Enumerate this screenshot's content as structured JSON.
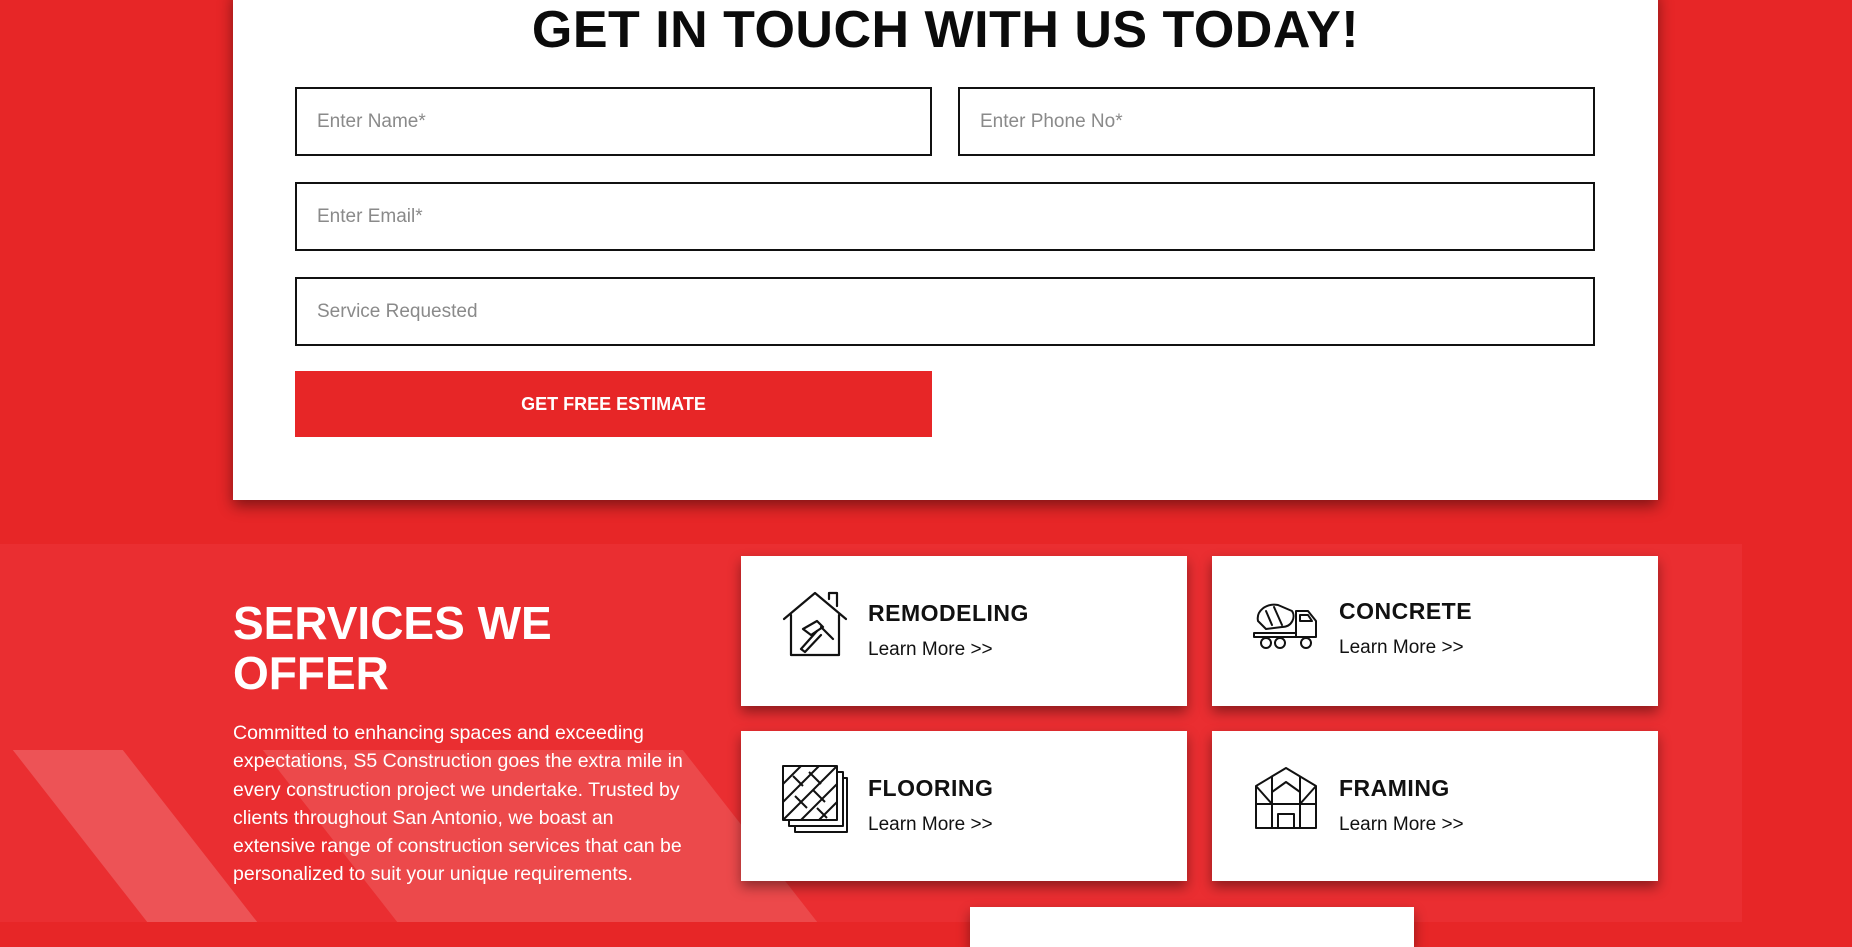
{
  "contact_form": {
    "title": "GET IN TOUCH WITH US TODAY!",
    "name_placeholder": "Enter Name*",
    "phone_placeholder": "Enter Phone No*",
    "email_placeholder": "Enter Email*",
    "service_placeholder": "Service Requested",
    "submit_label": "GET FREE ESTIMATE"
  },
  "services": {
    "heading": "SERVICES WE OFFER",
    "description": "Committed to enhancing spaces and exceeding expectations, S5 Construction goes the extra mile in every construction project we undertake. Trusted by clients throughout San Antonio, we boast an extensive range of construction services that can be personalized to suit your unique requirements.",
    "items": [
      {
        "title": "REMODELING",
        "link": "Learn More >>",
        "icon": "house-hammer-icon"
      },
      {
        "title": "CONCRETE",
        "link": "Learn More >>",
        "icon": "cement-truck-icon"
      },
      {
        "title": "FLOORING",
        "link": "Learn More >>",
        "icon": "floor-tiles-icon"
      },
      {
        "title": "FRAMING",
        "link": "Learn More >>",
        "icon": "house-frame-icon"
      }
    ]
  },
  "colors": {
    "brand_red": "#e72627",
    "card_bg": "#ffffff",
    "text_dark": "#111111"
  }
}
